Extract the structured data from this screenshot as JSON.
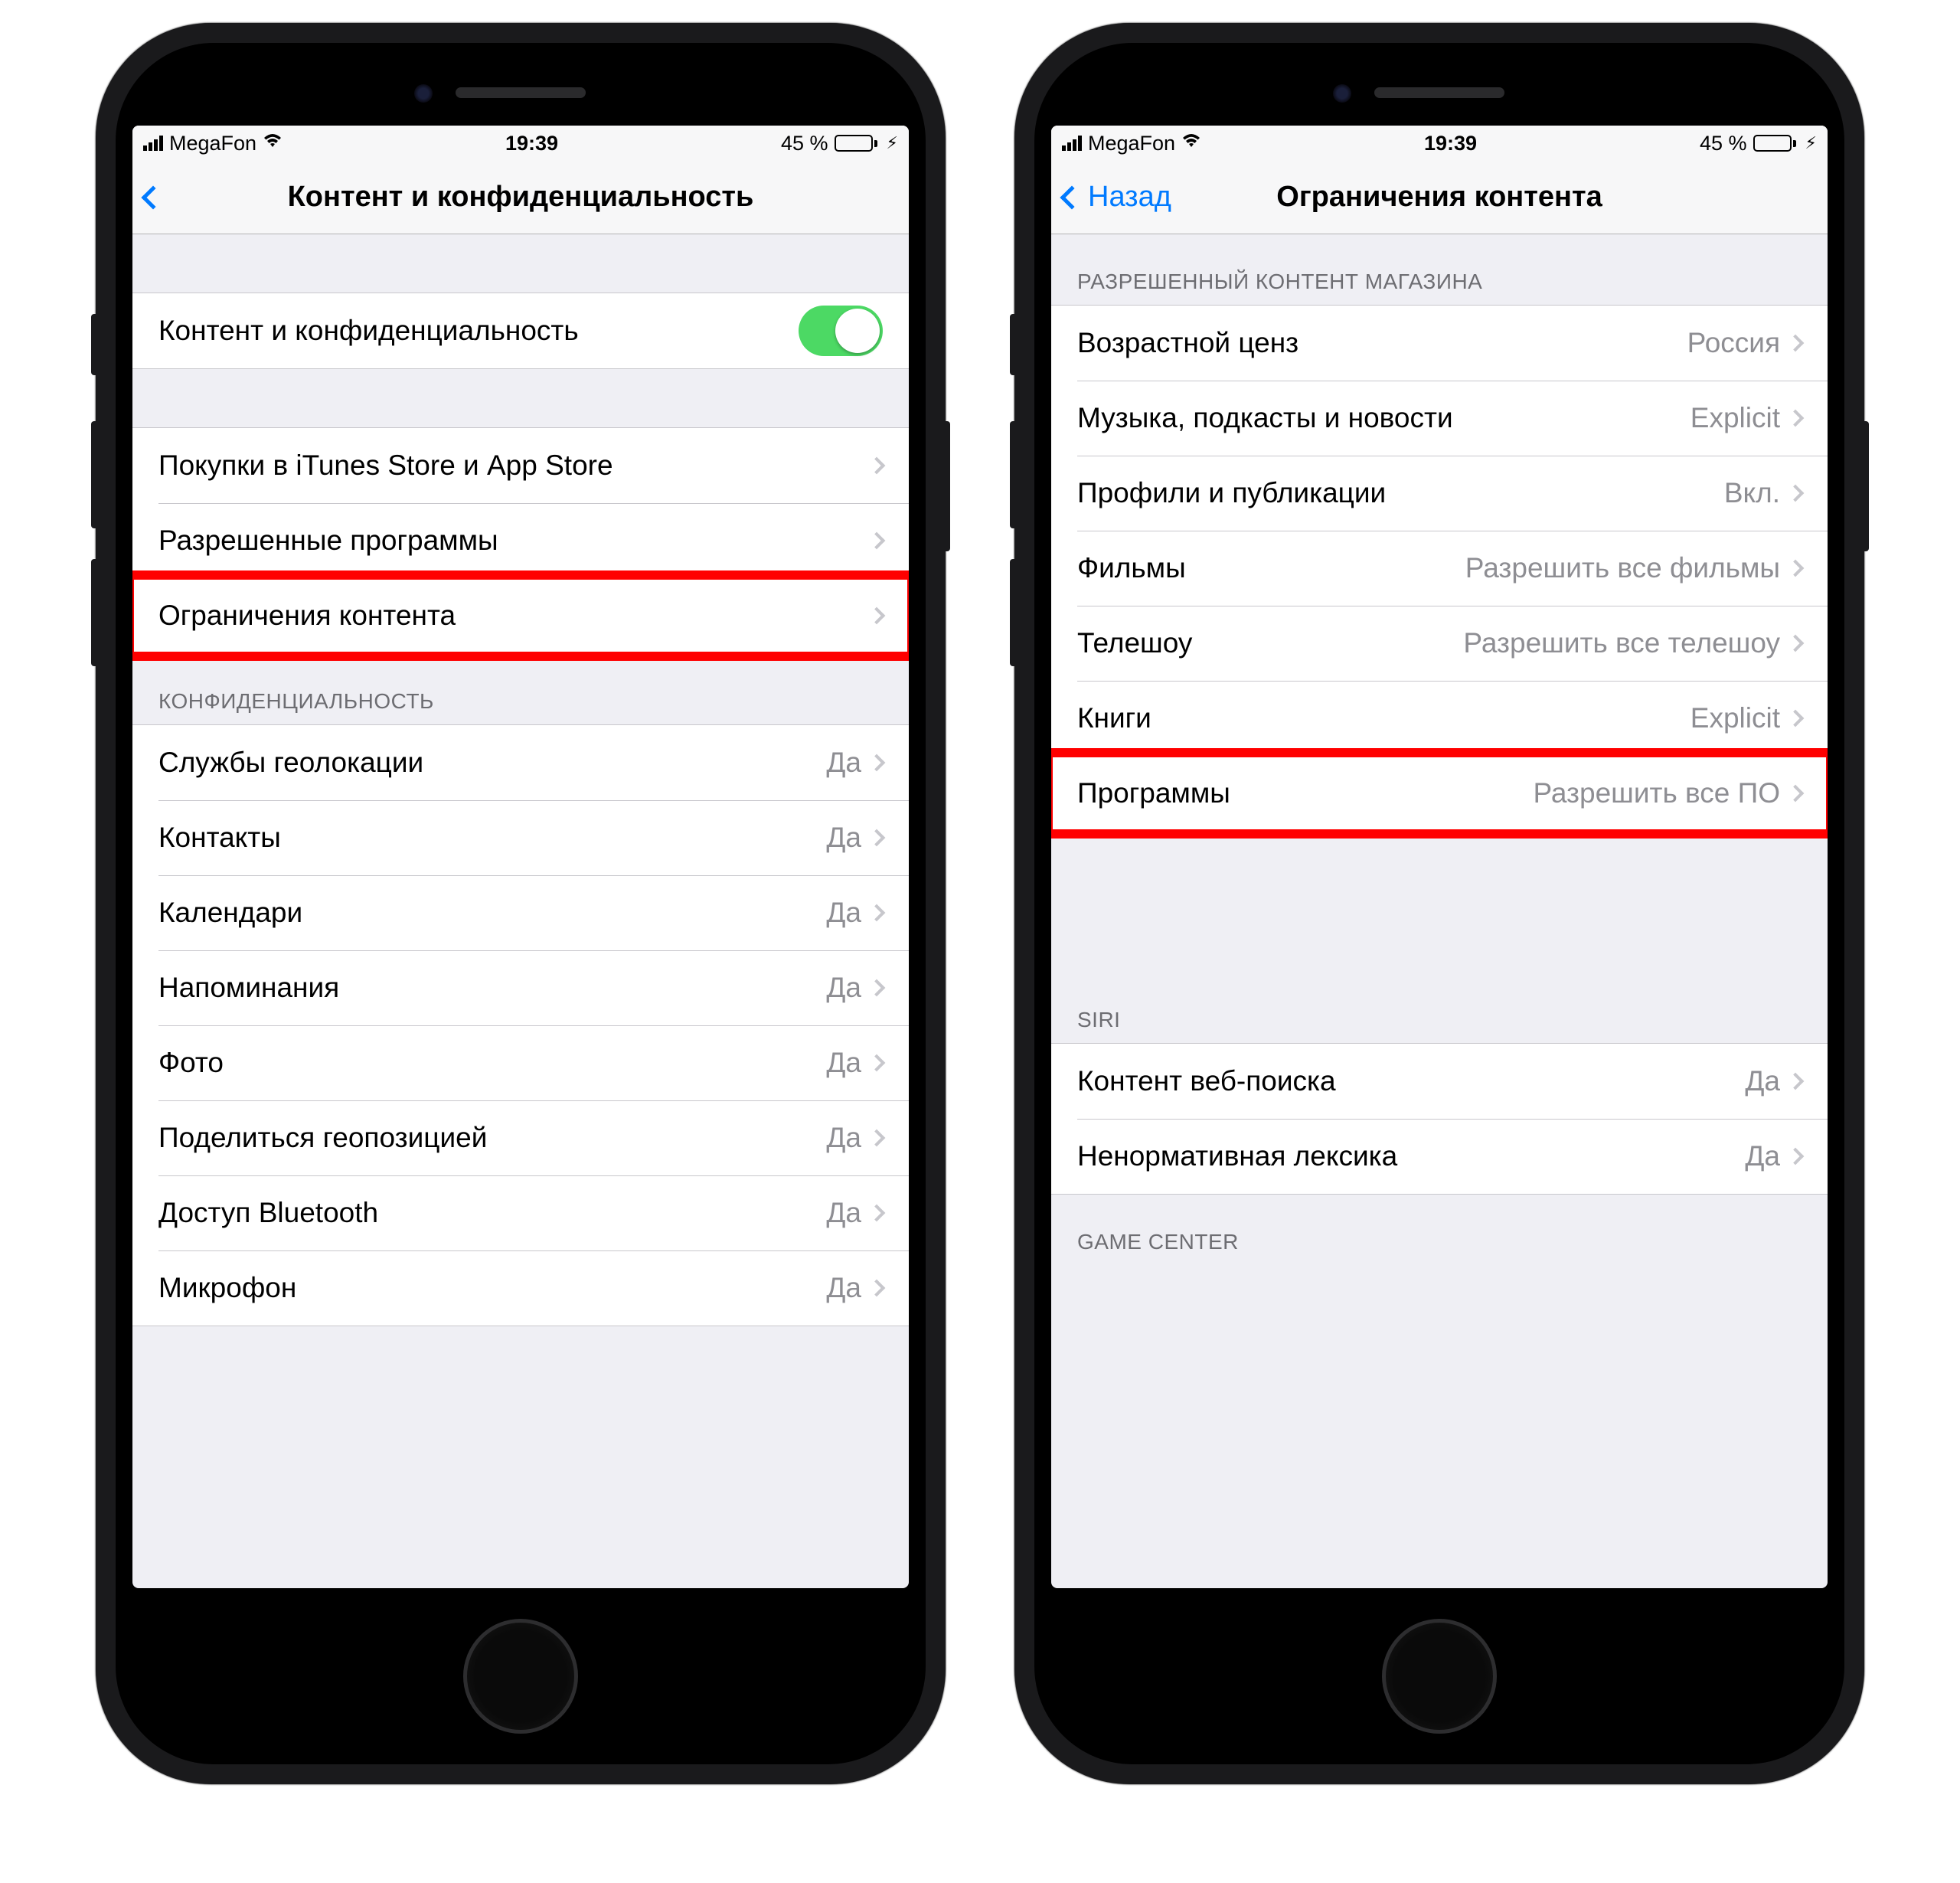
{
  "status": {
    "carrier": "MegaFon",
    "time": "19:39",
    "battery_pct": "45 %"
  },
  "left": {
    "nav_title": "Контент и конфиденциальность",
    "toggle_row_label": "Контент и конфиденциальность",
    "group1": {
      "purchases": "Покупки в iTunes Store и App Store",
      "allowed_apps": "Разрешенные программы",
      "content_restrictions": "Ограничения контента"
    },
    "privacy_header": "КОНФИДЕНЦИАЛЬНОСТЬ",
    "privacy_rows": [
      {
        "label": "Службы геолокации",
        "value": "Да"
      },
      {
        "label": "Контакты",
        "value": "Да"
      },
      {
        "label": "Календари",
        "value": "Да"
      },
      {
        "label": "Напоминания",
        "value": "Да"
      },
      {
        "label": "Фото",
        "value": "Да"
      },
      {
        "label": "Поделиться геопозицией",
        "value": "Да"
      },
      {
        "label": "Доступ Bluetooth",
        "value": "Да"
      },
      {
        "label": "Микрофон",
        "value": "Да"
      }
    ]
  },
  "right": {
    "nav_back": "Назад",
    "nav_title": "Ограничения контента",
    "store_header": "РАЗРЕШЕННЫЙ КОНТЕНТ МАГАЗИНА",
    "store_rows": [
      {
        "label": "Возрастной ценз",
        "value": "Россия"
      },
      {
        "label": "Музыка, подкасты и новости",
        "value": "Explicit"
      },
      {
        "label": "Профили и публикации",
        "value": "Вкл."
      },
      {
        "label": "Фильмы",
        "value": "Разрешить все фильмы"
      },
      {
        "label": "Телешоу",
        "value": "Разрешить все телешоу"
      },
      {
        "label": "Книги",
        "value": "Explicit"
      },
      {
        "label": "Программы",
        "value": "Разрешить все ПО"
      }
    ],
    "siri_header": "SIRI",
    "siri_rows": [
      {
        "label": "Контент веб-поиска",
        "value": "Да"
      },
      {
        "label": "Ненормативная лексика",
        "value": "Да"
      }
    ],
    "gc_header": "GAME CENTER"
  }
}
